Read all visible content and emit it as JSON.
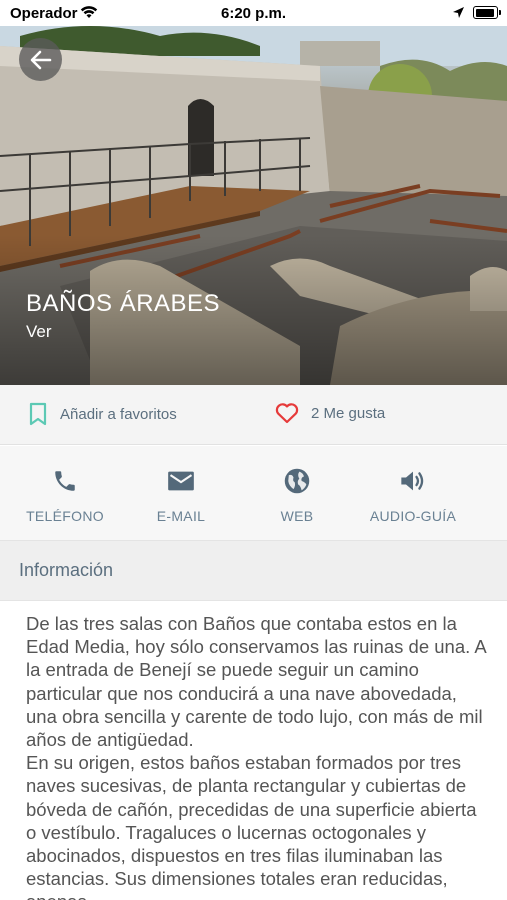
{
  "status_bar": {
    "carrier": "Operador",
    "time": "6:20 p.m."
  },
  "hero": {
    "title": "BAÑOS ÁRABES",
    "subtitle": "Ver",
    "back_icon": "arrow-left-icon"
  },
  "favorites": {
    "add_label": "Añadir a favoritos",
    "likes_label": "2 Me gusta",
    "bookmark_icon": "bookmark-outline-icon",
    "heart_icon": "heart-outline-icon",
    "accent_bookmark": "#5cc9b4",
    "accent_heart": "#e63a3a"
  },
  "actions": [
    {
      "label": "TELÉFONO",
      "icon": "phone-icon"
    },
    {
      "label": "E-MAIL",
      "icon": "mail-icon"
    },
    {
      "label": "WEB",
      "icon": "globe-icon"
    },
    {
      "label": "AUDIO-GUÍA",
      "icon": "speaker-icon"
    }
  ],
  "info": {
    "header": "Información",
    "body": "De las tres salas con Baños que contaba estos en la Edad Media, hoy sólo conservamos las ruinas de una. A la entrada de Benejí se puede seguir un camino particular que nos conducirá a una nave abovedada, una obra sencilla y carente de todo lujo, con más de mil años de antigüedad.\nEn su origen, estos baños estaban formados por tres naves sucesivas, de planta rectangular y cubiertas de bóveda de cañón, precedidas de una superficie abierta o vestíbulo. Tragaluces o lucernas octogonales y abocinados, dispuestos en tres filas iluminaban las estancias. Sus dimensiones totales eran reducidas, apenas"
  },
  "colors": {
    "icon_color": "#54697a",
    "text_color": "#5b6f7f"
  }
}
